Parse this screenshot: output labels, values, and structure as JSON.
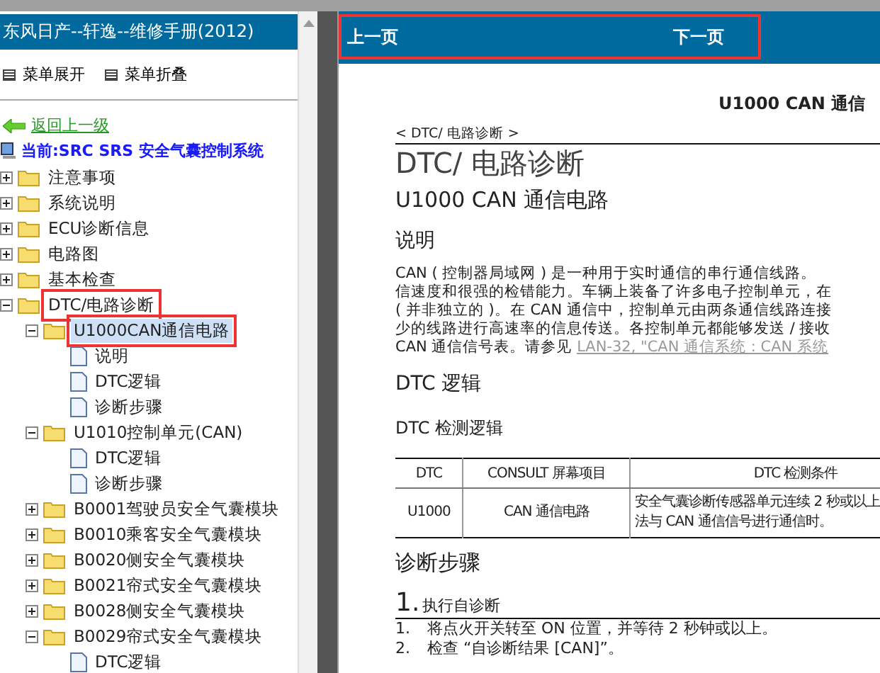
{
  "sidebar": {
    "title": "东风日产--轩逸--维修手册(2012)",
    "menu": [
      {
        "label": "菜单展开"
      },
      {
        "label": "菜单折叠"
      }
    ],
    "back_link": "返回上一级",
    "current": "当前:SRC SRS 安全气囊控制系统",
    "tree": [
      {
        "kind": "folder",
        "label": "注意事项",
        "expanded": false,
        "selected": false,
        "highlighted": false
      },
      {
        "kind": "folder",
        "label": "系统说明",
        "expanded": false,
        "selected": false,
        "highlighted": false
      },
      {
        "kind": "folder",
        "label": "ECU诊断信息",
        "expanded": false,
        "selected": false,
        "highlighted": false
      },
      {
        "kind": "folder",
        "label": "电路图",
        "expanded": false,
        "selected": false,
        "highlighted": false
      },
      {
        "kind": "folder",
        "label": "基本检查",
        "expanded": false,
        "selected": false,
        "highlighted": false
      },
      {
        "kind": "folder",
        "label": "DTC/电路诊断",
        "expanded": true,
        "selected": false,
        "highlighted": true,
        "children": [
          {
            "kind": "folder",
            "label": "U1000CAN通信电路",
            "expanded": true,
            "selected": true,
            "highlighted": true,
            "children": [
              {
                "kind": "page",
                "label": "说明",
                "selected": false,
                "highlighted": false
              },
              {
                "kind": "page",
                "label": "DTC逻辑",
                "selected": false,
                "highlighted": false
              },
              {
                "kind": "page",
                "label": "诊断步骤",
                "selected": false,
                "highlighted": false
              }
            ]
          },
          {
            "kind": "folder",
            "label": "U1010控制单元(CAN)",
            "expanded": true,
            "selected": false,
            "highlighted": false,
            "children": [
              {
                "kind": "page",
                "label": "DTC逻辑",
                "selected": false,
                "highlighted": false
              },
              {
                "kind": "page",
                "label": "诊断步骤",
                "selected": false,
                "highlighted": false
              }
            ]
          },
          {
            "kind": "folder",
            "label": "B0001驾驶员安全气囊模块",
            "expanded": false,
            "selected": false,
            "highlighted": false
          },
          {
            "kind": "folder",
            "label": "B0010乘客安全气囊模块",
            "expanded": false,
            "selected": false,
            "highlighted": false
          },
          {
            "kind": "folder",
            "label": "B0020侧安全气囊模块",
            "expanded": false,
            "selected": false,
            "highlighted": false
          },
          {
            "kind": "folder",
            "label": "B0021帘式安全气囊模块",
            "expanded": false,
            "selected": false,
            "highlighted": false
          },
          {
            "kind": "folder",
            "label": "B0028侧安全气囊模块",
            "expanded": false,
            "selected": false,
            "highlighted": false
          },
          {
            "kind": "folder",
            "label": "B0029帘式安全气囊模块",
            "expanded": true,
            "selected": false,
            "highlighted": false,
            "children": [
              {
                "kind": "page",
                "label": "DTC逻辑",
                "selected": false,
                "highlighted": false
              }
            ]
          }
        ]
      }
    ]
  },
  "page_nav": {
    "previous": "上一页",
    "next": "下一页",
    "highlighted": true
  },
  "document": {
    "page_title": "U1000 CAN 通信",
    "breadcrumb": "< DTC/ 电路诊断 >",
    "section_title": "DTC/ 电路诊断",
    "subtitle": "U1000 CAN 通信电路",
    "description_heading": "说明",
    "description_lines": [
      "CAN ( 控制器局域网 ) 是一种用于实时通信的串行通信线路。",
      "信速度和很强的检错能力。车辆上装备了许多电子控制单元，在",
      "( 并非独立的 )。在 CAN 通信中，控制单元由两条通信线路连接",
      "少的线路进行高速率的信息传送。各控制单元都能够发送 / 接收"
    ],
    "description_last_line": "CAN 通信信号表。请参见",
    "reference_link": "LAN-32, \"CAN 通信系统 : CAN 系统",
    "logic_heading": "DTC 逻辑",
    "logic_subheading": "DTC 检测逻辑",
    "table": {
      "columns": [
        "DTC",
        "CONSULT 屏幕项目",
        "DTC 检测条件"
      ],
      "rows": [
        {
          "cells": [
            "U1000",
            "CAN 通信电路",
            [
              "安全气囊诊断传感器单元连续 2 秒或以上",
              "法与 CAN 通信信号进行通信时。"
            ]
          ]
        }
      ]
    },
    "steps_heading": "诊断步骤",
    "step_number": "1.",
    "step_title": "执行自诊断",
    "step_items": [
      {
        "number": "1.",
        "text": "将点火开关转至 ON 位置，并等待 2 秒钟或以上。"
      },
      {
        "number": "2.",
        "text": "检查 “自诊断结果 [CAN]”。"
      }
    ]
  }
}
